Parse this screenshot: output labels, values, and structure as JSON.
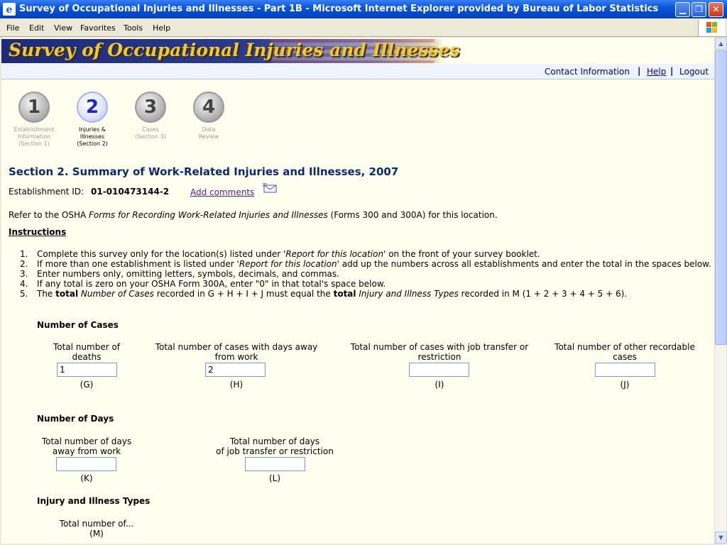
{
  "window": {
    "title": "Survey of Occupational Injuries and Illnesses - Part 1B - Microsoft Internet Explorer provided by Bureau of Labor Statistics",
    "menu": [
      "File",
      "Edit",
      "View",
      "Favorites",
      "Tools",
      "Help"
    ]
  },
  "banner": {
    "title": "Survey of Occupational Injuries and Illnesses"
  },
  "nav": {
    "contact": "Contact Information",
    "help": "Help",
    "logout": "Logout",
    "sep": "|"
  },
  "steps": [
    {
      "num": "1",
      "label1": "Establishment",
      "label2": "Information",
      "label3": "(Section 1)"
    },
    {
      "num": "2",
      "label1": "Injuries &",
      "label2": "Illnesses",
      "label3": "(Section 2)"
    },
    {
      "num": "3",
      "label1": "Cases",
      "label2": "(Section 3)",
      "label3": ""
    },
    {
      "num": "4",
      "label1": "Data",
      "label2": "Review",
      "label3": ""
    }
  ],
  "section": {
    "heading": "Section 2. Summary of Work-Related Injuries and Illnesses, 2007",
    "est_label": "Establishment ID:",
    "est_id": "01-010473144-2",
    "add_comments": "Add comments",
    "refer_pre": "Refer to the OSHA ",
    "refer_italic": "Forms for Recording Work-Related Injuries and Illnesses",
    "refer_post": " (Forms 300 and 300A) for this location.",
    "instructions_heading": "Instructions"
  },
  "instructions": [
    {
      "n": "1.",
      "a": "Complete this survey only for the location(s) listed under ",
      "b": "'Report for this location'",
      "c": " on the front of your survey booklet."
    },
    {
      "n": "2.",
      "a": "If more than one establishment is listed under ",
      "b": "'Report for this location'",
      "c": " add up the numbers across all establishments and enter the total in the spaces below."
    },
    {
      "n": "3.",
      "a": "Enter numbers only, omitting letters, symbols, decimals, and commas.",
      "b": "",
      "c": ""
    },
    {
      "n": "4.",
      "a": "If any total is zero on your OSHA Form 300A, enter \"0\" in that total's space below.",
      "b": "",
      "c": ""
    }
  ],
  "instruction5": {
    "n": "5.",
    "p1": "The ",
    "b1": "total",
    "i1": " Number of Cases",
    "p2": " recorded in G + H + I + J must equal the ",
    "b2": "total",
    "i2": " Injury and Illness Types",
    "p3": " recorded in M (1 + 2 + 3 + 4 + 5 + 6)."
  },
  "cases": {
    "heading": "Number of Cases",
    "g": {
      "l1": "Total number of",
      "l2": "deaths",
      "value": "1",
      "code": "(G)"
    },
    "h": {
      "l1": "Total number of cases with days away",
      "l2": "from work",
      "value": "2",
      "code": "(H)"
    },
    "i": {
      "l1": "Total number of cases with job transfer or",
      "l2": "restriction",
      "value": "",
      "code": "(I)"
    },
    "j": {
      "l1": "Total number of other recordable",
      "l2": "cases",
      "value": "",
      "code": "(J)"
    }
  },
  "days": {
    "heading": "Number of Days",
    "k": {
      "l1": "Total number of days",
      "l2": "away from work",
      "value": "",
      "code": "(K)"
    },
    "l": {
      "l1": "Total number of days",
      "l2": "of job transfer or restriction",
      "value": "",
      "code": "(L)"
    }
  },
  "types": {
    "heading": "Injury and Illness Types",
    "m_label": "Total number of...",
    "m_code": "(M)"
  }
}
